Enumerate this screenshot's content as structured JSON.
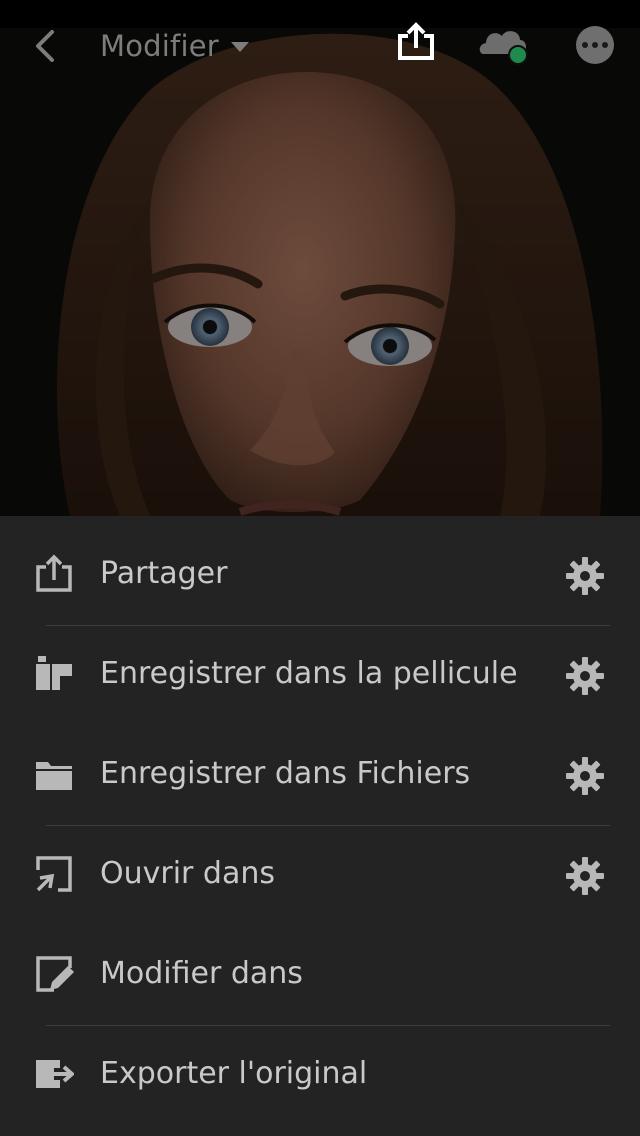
{
  "header": {
    "title": "Modifier",
    "icons": {
      "back": "chevron-left-icon",
      "share": "share-icon",
      "cloud": "cloud-sync-icon",
      "more": "more-icon"
    },
    "cloud_status_color": "#1e8a4c"
  },
  "menu": {
    "items": [
      {
        "label": "Partager",
        "icon": "share-icon",
        "has_settings": true
      },
      {
        "label": "Enregistrer dans la pellicule",
        "icon": "camera-roll-icon",
        "has_settings": true
      },
      {
        "label": "Enregistrer dans Fichiers",
        "icon": "folder-icon",
        "has_settings": true
      },
      {
        "label": "Ouvrir dans",
        "icon": "open-in-icon",
        "has_settings": true
      },
      {
        "label": "Modifier dans",
        "icon": "edit-in-icon",
        "has_settings": false
      },
      {
        "label": "Exporter l'original",
        "icon": "export-original-icon",
        "has_settings": false
      }
    ]
  },
  "colors": {
    "sheet_background": "#232323",
    "text": "#c9c9c9",
    "icon": "#b8b8b8"
  }
}
